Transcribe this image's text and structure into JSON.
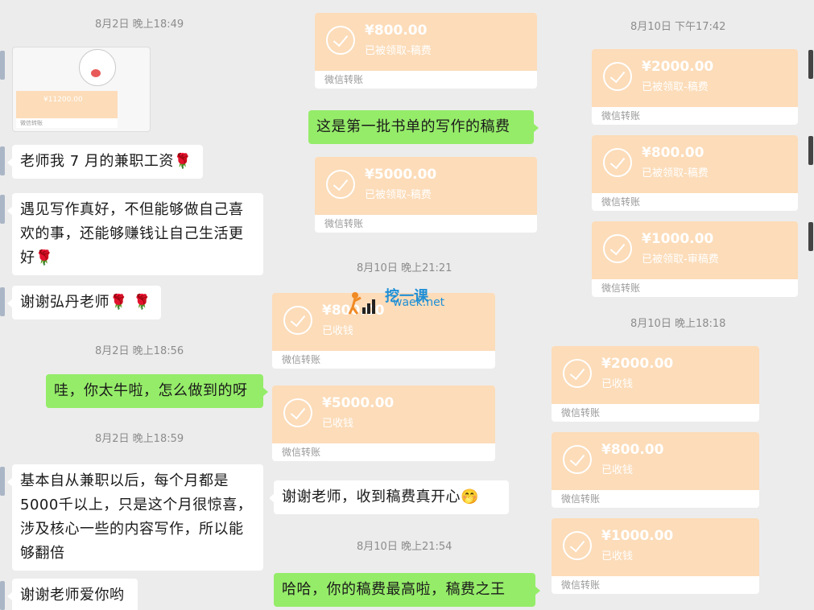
{
  "col1": {
    "ts1": "8月2日 晚上18:49",
    "img_amount": "¥11200.00",
    "img_label": "微信转账",
    "msg1": "老师我 7 月的兼职工资🌹",
    "msg2": "遇见写作真好，不但能够做自己喜欢的事，还能够赚钱让自己生活更好🌹",
    "msg3": "谢谢弘丹老师🌹 🌹",
    "ts2": "8月2日 晚上18:56",
    "msg4": "哇，你太牛啦，怎么做到的呀",
    "ts3": "8月2日 晚上18:59",
    "msg5": "基本自从兼职以后，每个月都是5000千以上，只是这个月很惊喜，涉及核心一些的内容写作，所以能够翻倍",
    "msg6": "谢谢老师爱你哟"
  },
  "col2": {
    "card1": {
      "amount": "¥800.00",
      "status": "已被领取-稿费",
      "label": "微信转账"
    },
    "msg1": "这是第一批书单的写作的稿费",
    "card2": {
      "amount": "¥5000.00",
      "status": "已被领取-稿费",
      "label": "微信转账"
    },
    "ts1": "8月10日 晚上21:21",
    "card3": {
      "amount": "¥800.00",
      "status": "已收钱",
      "label": "微信转账"
    },
    "card4": {
      "amount": "¥5000.00",
      "status": "已收钱",
      "label": "微信转账"
    },
    "msg2": "谢谢老师，收到稿费真开心🤭",
    "ts2": "8月10日 晚上21:54",
    "msg3": "哈哈，你的稿费最高啦，稿费之王"
  },
  "col3": {
    "ts1": "8月10日 下午17:42",
    "card1": {
      "amount": "¥2000.00",
      "status": "已被领取-稿费",
      "label": "微信转账"
    },
    "card2": {
      "amount": "¥800.00",
      "status": "已被领取-稿费",
      "label": "微信转账"
    },
    "card3": {
      "amount": "¥1000.00",
      "status": "已被领取-审稿费",
      "label": "微信转账"
    },
    "ts2": "8月10日 晚上18:18",
    "card4": {
      "amount": "¥2000.00",
      "status": "已收钱",
      "label": "微信转账"
    },
    "card5": {
      "amount": "¥800.00",
      "status": "已收钱",
      "label": "微信转账"
    },
    "card6": {
      "amount": "¥1000.00",
      "status": "已收钱",
      "label": "微信转账"
    }
  },
  "watermark": {
    "title": "挖一课",
    "subtitle": "waek.net"
  },
  "colors": {
    "green_bubble": "#95ec69",
    "transfer_card": "#fcdcb9",
    "background": "#ededed"
  }
}
